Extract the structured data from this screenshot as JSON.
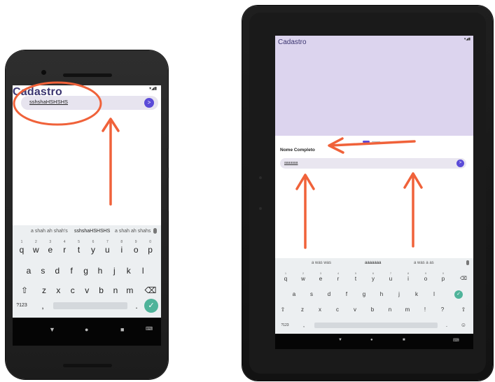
{
  "phone": {
    "status_right": "▾◢▮",
    "title": "Cadastro",
    "input_value": "sshshaHSHSHS",
    "send_glyph": ">",
    "suggestions": [
      "a shah ah shah's",
      "sshshaHSHSHS",
      "a shah ah shahs"
    ],
    "row1": [
      [
        "q",
        "1"
      ],
      [
        "w",
        "2"
      ],
      [
        "e",
        "3"
      ],
      [
        "r",
        "4"
      ],
      [
        "t",
        "5"
      ],
      [
        "y",
        "6"
      ],
      [
        "u",
        "7"
      ],
      [
        "i",
        "8"
      ],
      [
        "o",
        "9"
      ],
      [
        "p",
        "0"
      ]
    ],
    "row2": [
      "a",
      "s",
      "d",
      "f",
      "g",
      "h",
      "j",
      "k",
      "l"
    ],
    "row3": [
      "z",
      "x",
      "c",
      "v",
      "b",
      "n",
      "m"
    ],
    "shift_glyph": "⇧",
    "backspace_glyph": "⌫",
    "symbols_label": "?123",
    "comma": ",",
    "period": ".",
    "enter_glyph": "✓",
    "nav": {
      "back": "▼",
      "home": "●",
      "recents": "■",
      "keyboard": "⌨"
    }
  },
  "tablet": {
    "status_left": "",
    "status_right": "▾◢▮",
    "title": "Cadastro",
    "field_label": "Nome Completo",
    "input_value": "aaaaaaa",
    "send_glyph": ">",
    "suggestions": [
      "a was was",
      "aaaaaaa",
      "a was a as"
    ],
    "row1": [
      [
        "q",
        "1"
      ],
      [
        "w",
        "2"
      ],
      [
        "e",
        "3"
      ],
      [
        "r",
        "4"
      ],
      [
        "t",
        "5"
      ],
      [
        "y",
        "6"
      ],
      [
        "u",
        "7"
      ],
      [
        "i",
        "8"
      ],
      [
        "o",
        "9"
      ],
      [
        "p",
        "0"
      ]
    ],
    "row2": [
      "a",
      "s",
      "d",
      "f",
      "g",
      "h",
      "j",
      "k",
      "l"
    ],
    "row3": [
      "z",
      "x",
      "c",
      "v",
      "b",
      "n",
      "m",
      "!",
      "?"
    ],
    "backspace_glyph": "⌫",
    "shift_glyph": "⇧",
    "enter_glyph": "✓",
    "symbols_label": "?123",
    "comma": ",",
    "period": ".",
    "emoji_glyph": "☺",
    "nav": {
      "back": "▼",
      "home": "●",
      "recents": "■",
      "keyboard": "⌨"
    }
  },
  "colors": {
    "accent": "#5b4bd8",
    "title": "#3b3570",
    "annotation": "#f0623a",
    "tablet_header": "#dcd4ee",
    "enter_key": "#4fb39a"
  }
}
